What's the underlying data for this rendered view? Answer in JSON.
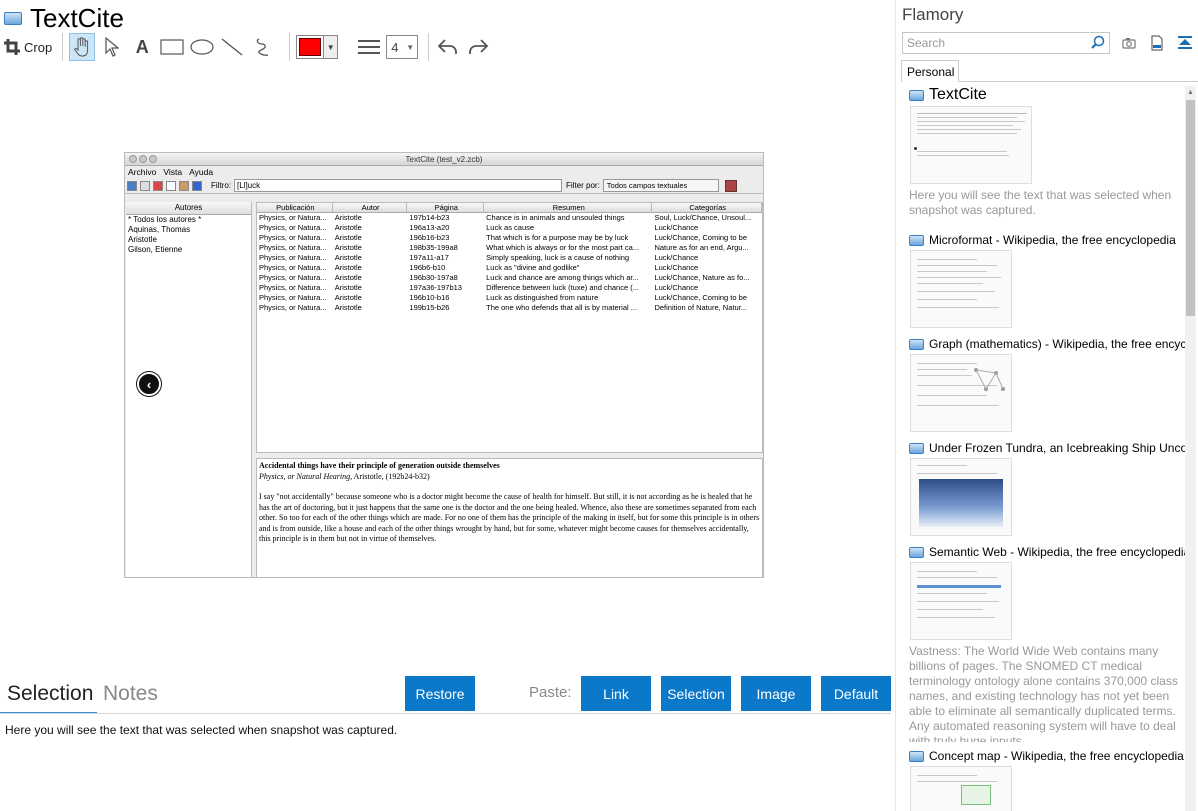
{
  "app": {
    "title": "TextCite"
  },
  "toolbar": {
    "crop_label": "Crop",
    "line_width": "4"
  },
  "snapshot": {
    "window_title": "TextCite (test_v2.zcb)",
    "menu": [
      "Archivo",
      "Vista",
      "Ayuda"
    ],
    "filter_label": "Filtro:",
    "filter_value": "[Ll]uck",
    "filter_by_label": "Filter por:",
    "filter_by_value": "Todos campos textuales",
    "authors_header": "Autores",
    "authors": [
      "* Todos los autores *",
      "Aquinas, Thomas",
      "Aristotle",
      "Gilson, Etienne"
    ],
    "columns": [
      "Publicación",
      "Autor",
      "Página",
      "Resumen",
      "Categorías"
    ],
    "rows": [
      [
        "Physics, or Natura...",
        "Aristotle",
        "197b14-b23",
        "Chance is in animals and unsouled things",
        "Soul, Luck/Chance, Unsoul..."
      ],
      [
        "Physics, or Natura...",
        "Aristotle",
        "196a13-a20",
        "Luck as cause",
        "Luck/Chance"
      ],
      [
        "Physics, or Natura...",
        "Aristotle",
        "196b16-b23",
        "That which is for a purpose may be by luck",
        "Luck/Chance, Coming to be"
      ],
      [
        "Physics, or Natura...",
        "Aristotle",
        "198b35-199a8",
        "What which is always or for the most part ca...",
        "Nature as for an end, Argu..."
      ],
      [
        "Physics, or Natura...",
        "Aristotle",
        "197a11-a17",
        "Simply speaking, luck is a cause of nothing",
        "Luck/Chance"
      ],
      [
        "Physics, or Natura...",
        "Aristotle",
        "196b6-b10",
        "Luck as \"divine and godlike\"",
        "Luck/Chance"
      ],
      [
        "Physics, or Natura...",
        "Aristotle",
        "196b30-197a8",
        "Luck and chance are among things which ar...",
        "Luck/Chance, Nature as fo..."
      ],
      [
        "Physics, or Natura...",
        "Aristotle",
        "197a36-197b13",
        "Difference between luck (tuxe) and chance (...",
        "Luck/Chance"
      ],
      [
        "Physics, or Natura...",
        "Aristotle",
        "196b10-b16",
        "Luck as distinguished from nature",
        "Luck/Chance, Coming to be"
      ],
      [
        "Physics, or Natura...",
        "Aristotle",
        "199b15-b26",
        "The one who defends that all is by material ...",
        "Definition of Nature, Natur..."
      ]
    ],
    "detail_title": "Accidental things have their principle of generation outside themselves",
    "detail_source_italic": "Physics, or Natural Hearing,",
    "detail_source_rest": " Aristotle, (192b24-b32)",
    "detail_body": "I say \"not accidentally\" because someone who is a doctor might become the cause of health for himself. But still, it is not according as he is healed that he has the art of doctoring, but it just happens that the same one is the doctor and the one being healed. Whence, also these are sometimes separated from each other. So too for each of the other things which are made. For no one of them has the principle of the making in itself, but for some this principle is in others and is from outside, like a house and each of the other things wrought by hand, but for some, whatever might become causes for themselves accidentally, this principle is in them but not in virtue of themselves."
  },
  "bottom": {
    "tab_selection": "Selection",
    "tab_notes": "Notes",
    "restore_label": "Restore",
    "paste_label": "Paste:",
    "link_label": "Link",
    "selection_label": "Selection",
    "image_label": "Image",
    "default_label": "Default",
    "selection_text": "Here you will see the text that was selected when snapshot was captured."
  },
  "sidebar": {
    "title": "Flamory",
    "search_placeholder": "Search",
    "tab_personal": "Personal",
    "items": [
      {
        "title": "TextCite",
        "desc": "Here you will see the text that was selected when snapshot was captured."
      },
      {
        "title": "Microformat - Wikipedia, the free encyclopedia",
        "desc": ""
      },
      {
        "title": "Graph (mathematics) - Wikipedia, the free encyclopedia",
        "desc": ""
      },
      {
        "title": "Under Frozen Tundra, an Icebreaking Ship Uncovers",
        "desc": ""
      },
      {
        "title": "Semantic Web - Wikipedia, the free encyclopedia",
        "desc": "Vastness: The World Wide Web contains many billions of pages. The SNOMED CT medical terminology ontology alone contains 370,000 class names, and existing technology has not yet been able to eliminate all semantically duplicated terms. Any automated reasoning system will have to deal with truly huge inputs."
      },
      {
        "title": "Concept map - Wikipedia, the free encyclopedia",
        "desc": ""
      }
    ]
  },
  "colors": {
    "accent": "#0b78c9",
    "stroke_color": "#ff0000"
  }
}
